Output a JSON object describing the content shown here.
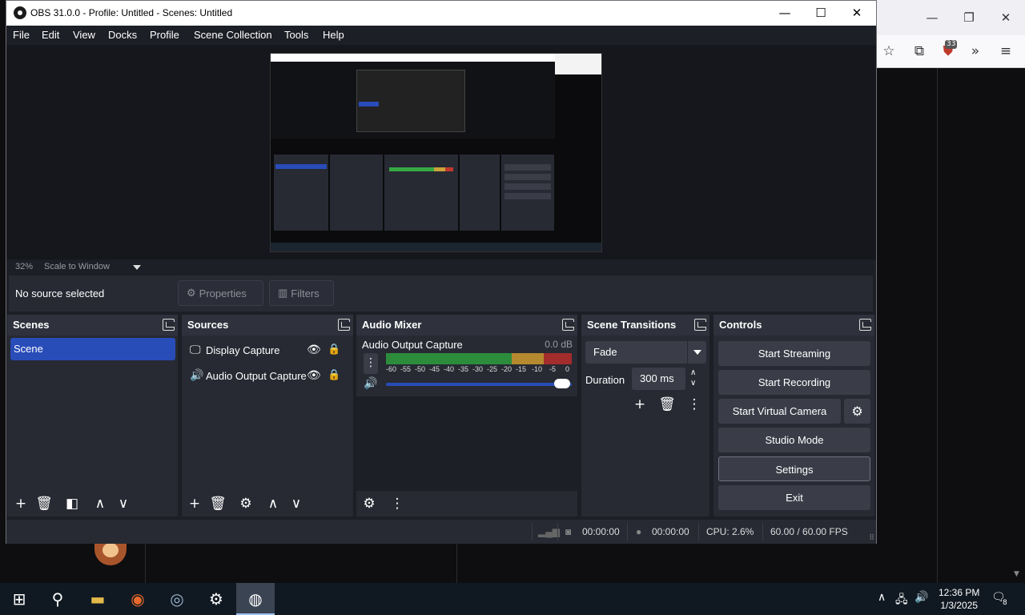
{
  "window": {
    "title": "OBS 31.0.0 - Profile: Untitled - Scenes: Untitled",
    "minimize_glyph": "—",
    "maximize_glyph": "☐",
    "close_glyph": "✕"
  },
  "menu": [
    "File",
    "Edit",
    "View",
    "Docks",
    "Profile",
    "Scene Collection",
    "Tools",
    "Help"
  ],
  "preview": {
    "zoom": "32%",
    "scale_mode": "Scale to Window"
  },
  "context_bar": {
    "selection_text": "No source selected",
    "properties_label": "Properties",
    "filters_label": "Filters"
  },
  "docks": {
    "scenes": {
      "title": "Scenes",
      "items": [
        "Scene"
      ]
    },
    "sources": {
      "title": "Sources",
      "items": [
        {
          "label": "Display Capture",
          "icon": "monitor-icon"
        },
        {
          "label": "Audio Output Capture",
          "icon": "speaker-icon"
        }
      ]
    },
    "audio_mixer": {
      "title": "Audio Mixer",
      "channel_name": "Audio Output Capture",
      "db": "0.0 dB",
      "ticks": [
        "-60",
        "-55",
        "-50",
        "-45",
        "-40",
        "-35",
        "-30",
        "-25",
        "-20",
        "-15",
        "-10",
        "-5",
        "0"
      ],
      "volume": 1.0
    },
    "scene_transitions": {
      "title": "Scene Transitions",
      "transition": "Fade",
      "duration_label": "Duration",
      "duration_value": "300 ms"
    },
    "controls": {
      "title": "Controls",
      "start_streaming": "Start Streaming",
      "start_recording": "Start Recording",
      "start_virtual_camera": "Start Virtual Camera",
      "studio_mode": "Studio Mode",
      "settings": "Settings",
      "exit": "Exit"
    }
  },
  "status_bar": {
    "stream_time": "00:00:00",
    "record_time": "00:00:00",
    "cpu": "CPU: 2.6%",
    "fps": "60.00 / 60.00 FPS"
  },
  "taskbar": {
    "time": "12:36 PM",
    "date": "1/3/2025",
    "notification_count": "8"
  },
  "browser": {
    "extension_badge": "33"
  },
  "colors": {
    "accent_blue": "#284cb8",
    "panel_bg": "#272a33",
    "window_bg": "#1d1f26"
  }
}
